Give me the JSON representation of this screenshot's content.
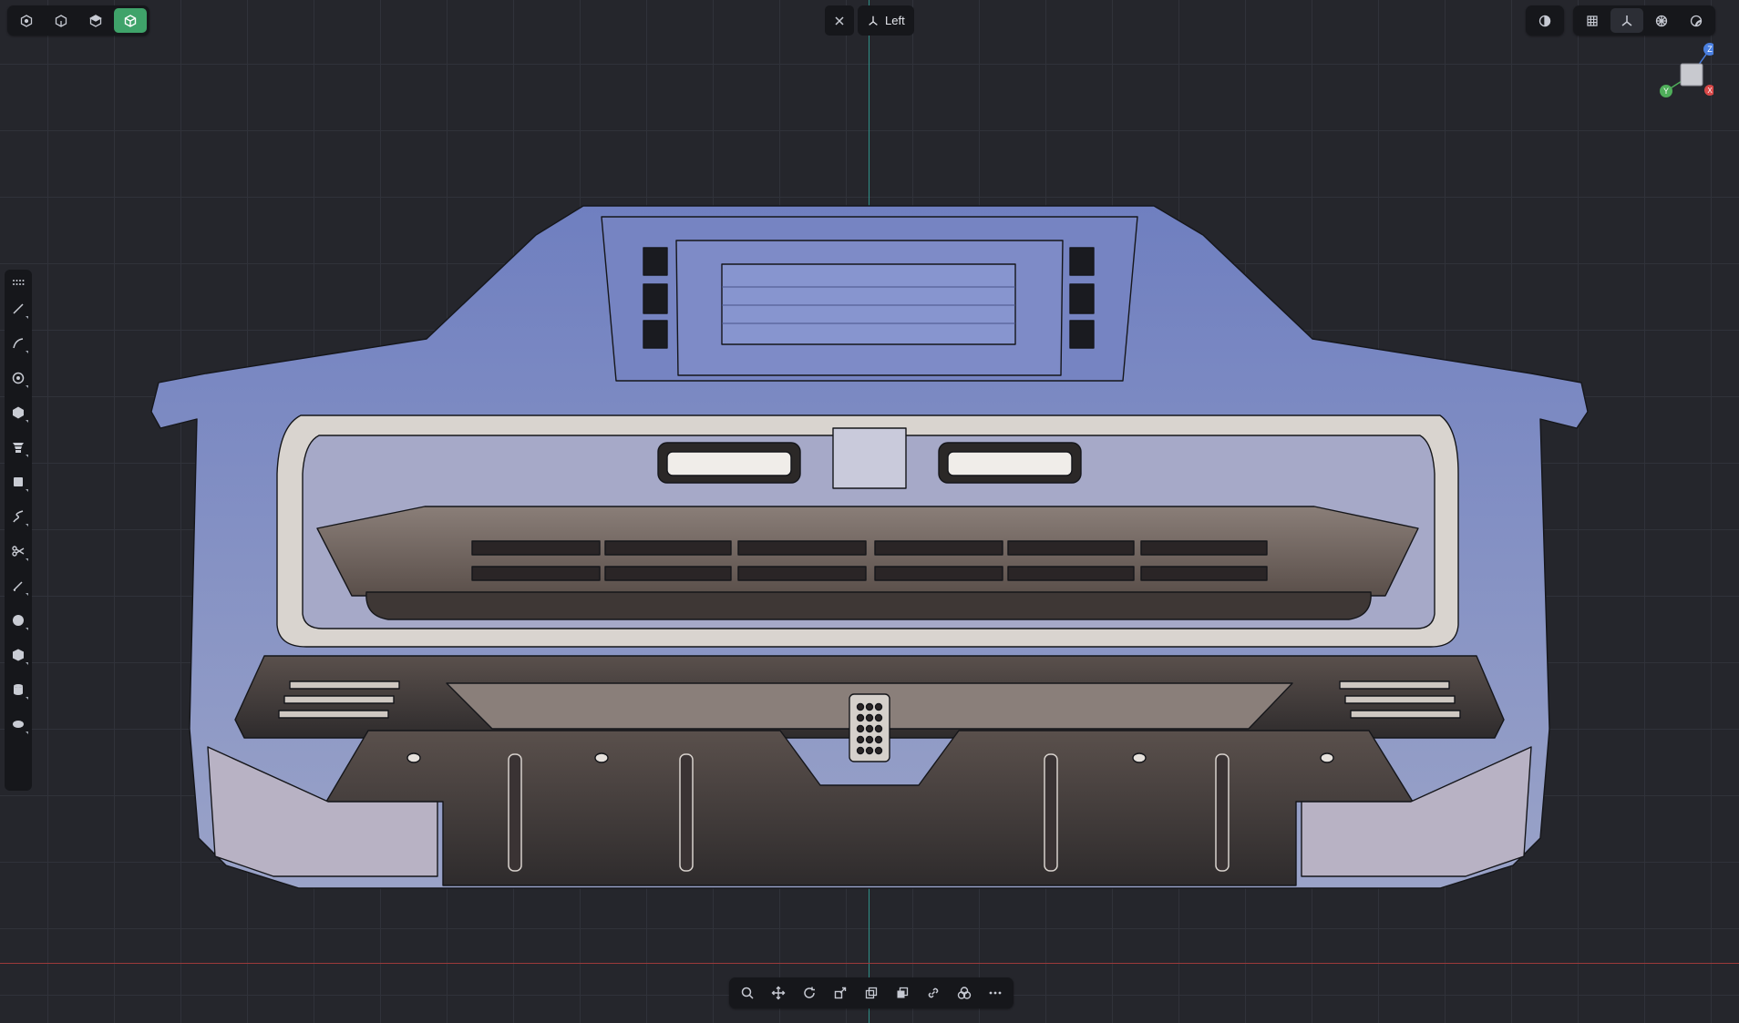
{
  "top_left_toolbar": {
    "modes": [
      {
        "name": "vertex-mode",
        "icon": "vertex-select-icon",
        "active": false
      },
      {
        "name": "edge-mode",
        "icon": "edge-select-icon",
        "active": false
      },
      {
        "name": "face-mode",
        "icon": "face-select-icon",
        "active": false
      },
      {
        "name": "object-mode",
        "icon": "object-select-icon",
        "active": true
      }
    ]
  },
  "view_selector": {
    "close_icon": "close-icon",
    "view_icon": "axes-icon",
    "label": "Left"
  },
  "top_right_toolbar": {
    "display_group": [
      {
        "name": "shading-toggle",
        "icon": "half-circle-icon"
      }
    ],
    "view_group": [
      {
        "name": "grid-toggle",
        "icon": "grid-icon"
      },
      {
        "name": "axes-toggle",
        "icon": "axes-icon",
        "highlighted": true
      },
      {
        "name": "snapping-toggle",
        "icon": "snap-icon"
      },
      {
        "name": "environment-toggle",
        "icon": "sphere-icon"
      }
    ]
  },
  "left_toolbar": {
    "tools": [
      "line-tool-icon",
      "curve-tool-icon",
      "circle-tool-icon",
      "polygon-tool-icon",
      "extrude-tool-icon",
      "box-select-icon",
      "spline-tool-icon",
      "trim-tool-icon",
      "pen-tool-icon",
      "sphere-tool-icon",
      "cube-tool-icon",
      "cylinder-tool-icon",
      "torus-tool-icon"
    ]
  },
  "bottom_toolbar": {
    "tools": [
      "zoom-icon",
      "move-icon",
      "rotate-icon",
      "scale-icon",
      "duplicate-icon",
      "boolean-icon",
      "link-icon",
      "group-icon",
      "more-icon"
    ]
  },
  "gizmo": {
    "z_label": "Z",
    "y_label": "Y",
    "x_label": "X",
    "z_color": "#4a7fe0",
    "y_color": "#4fae5a",
    "x_color": "#d94848"
  },
  "colors": {
    "accent": "#3fa36a",
    "background": "#25262c",
    "grid": "#30323a",
    "axis_vertical": "#2f8f88",
    "axis_horizontal": "#9b3a3a"
  }
}
